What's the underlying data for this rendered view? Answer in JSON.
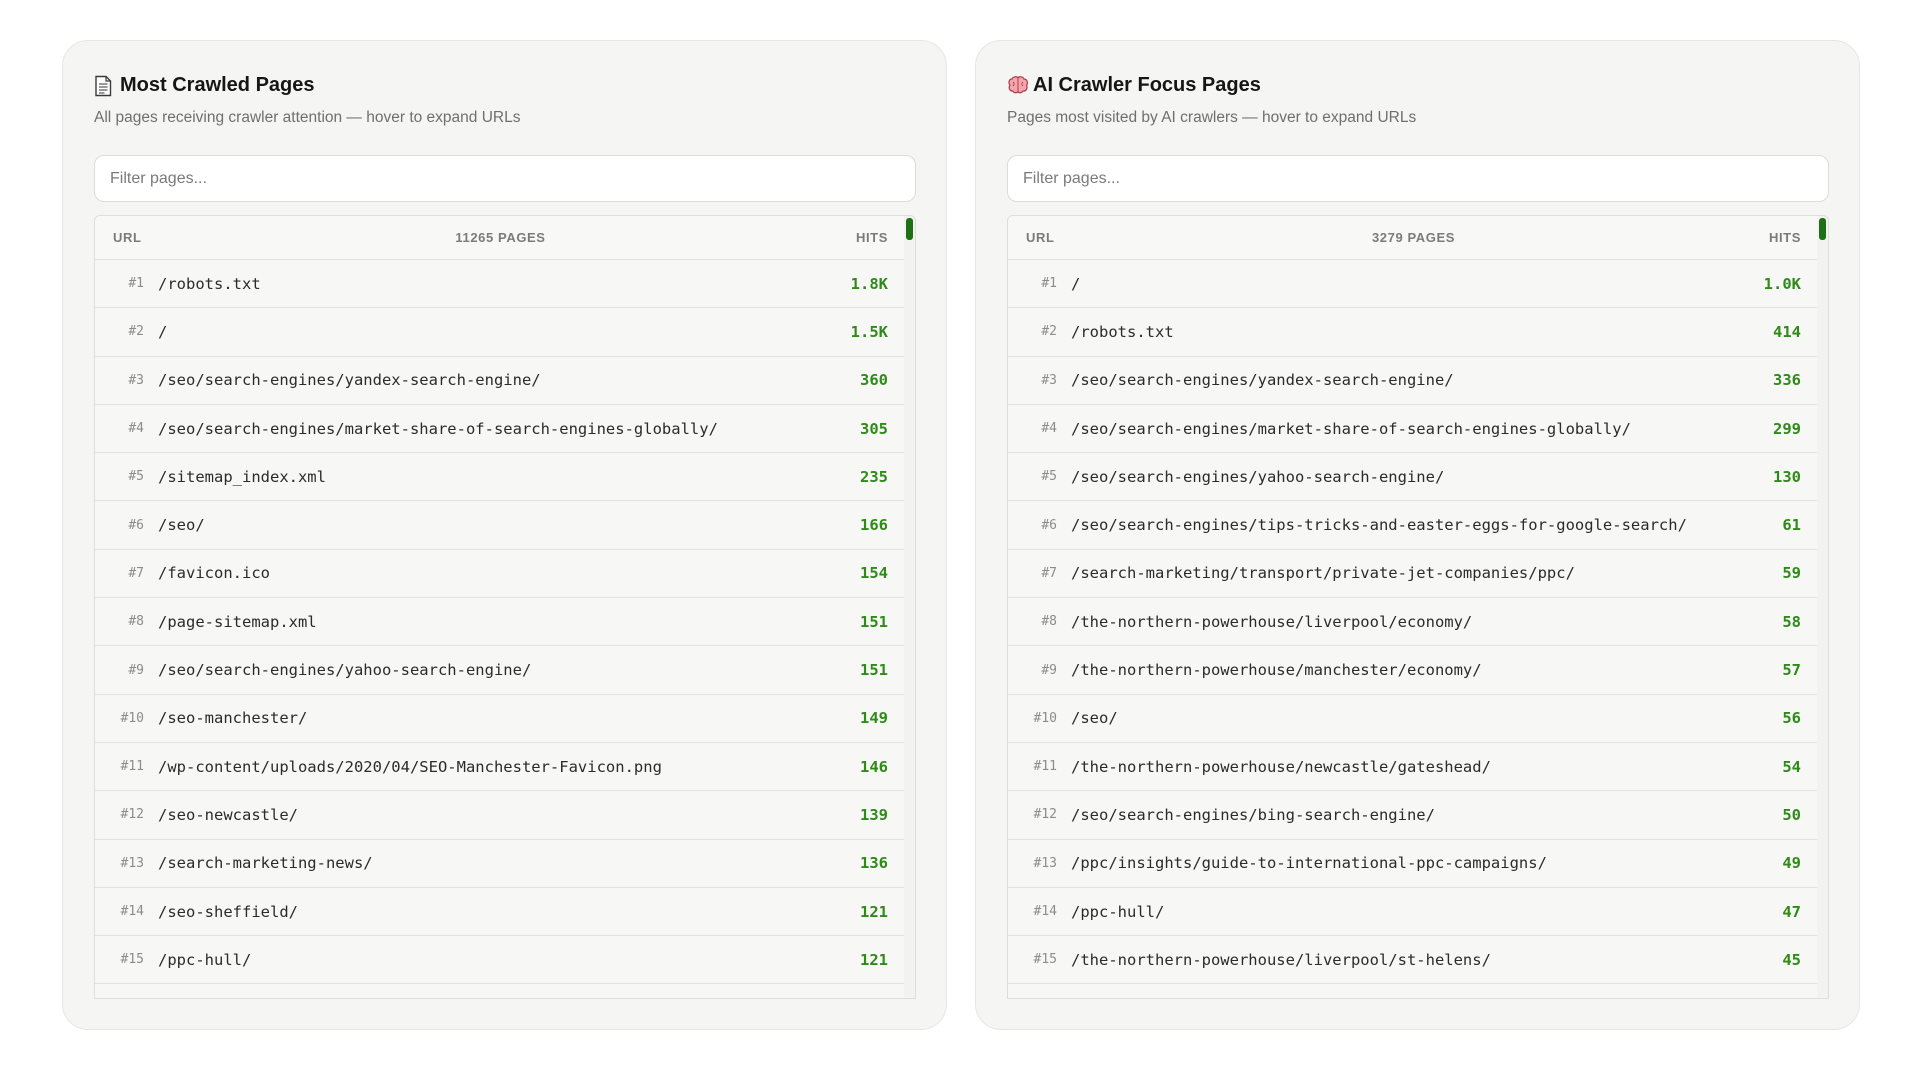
{
  "panels": [
    {
      "icon": "page-facing-up-icon",
      "title": "Most Crawled Pages",
      "subtitle": "All pages receiving crawler attention — hover to expand URLs",
      "filter_placeholder": "Filter pages...",
      "header": {
        "url": "URL",
        "count": "11265 PAGES",
        "hits": "HITS"
      },
      "rows": [
        {
          "rank": "#1",
          "url": "/robots.txt",
          "hits": "1.8K"
        },
        {
          "rank": "#2",
          "url": "/",
          "hits": "1.5K"
        },
        {
          "rank": "#3",
          "url": "/seo/search-engines/yandex-search-engine/",
          "hits": "360"
        },
        {
          "rank": "#4",
          "url": "/seo/search-engines/market-share-of-search-engines-globally/",
          "hits": "305"
        },
        {
          "rank": "#5",
          "url": "/sitemap_index.xml",
          "hits": "235"
        },
        {
          "rank": "#6",
          "url": "/seo/",
          "hits": "166"
        },
        {
          "rank": "#7",
          "url": "/favicon.ico",
          "hits": "154"
        },
        {
          "rank": "#8",
          "url": "/page-sitemap.xml",
          "hits": "151"
        },
        {
          "rank": "#9",
          "url": "/seo/search-engines/yahoo-search-engine/",
          "hits": "151"
        },
        {
          "rank": "#10",
          "url": "/seo-manchester/",
          "hits": "149"
        },
        {
          "rank": "#11",
          "url": "/wp-content/uploads/2020/04/SEO-Manchester-Favicon.png",
          "hits": "146"
        },
        {
          "rank": "#12",
          "url": "/seo-newcastle/",
          "hits": "139"
        },
        {
          "rank": "#13",
          "url": "/search-marketing-news/",
          "hits": "136"
        },
        {
          "rank": "#14",
          "url": "/seo-sheffield/",
          "hits": "121"
        },
        {
          "rank": "#15",
          "url": "/ppc-hull/",
          "hits": "121"
        }
      ]
    },
    {
      "icon": "brain-icon",
      "title": "AI Crawler Focus Pages",
      "subtitle": "Pages most visited by AI crawlers — hover to expand URLs",
      "filter_placeholder": "Filter pages...",
      "header": {
        "url": "URL",
        "count": "3279 PAGES",
        "hits": "HITS"
      },
      "rows": [
        {
          "rank": "#1",
          "url": "/",
          "hits": "1.0K"
        },
        {
          "rank": "#2",
          "url": "/robots.txt",
          "hits": "414"
        },
        {
          "rank": "#3",
          "url": "/seo/search-engines/yandex-search-engine/",
          "hits": "336"
        },
        {
          "rank": "#4",
          "url": "/seo/search-engines/market-share-of-search-engines-globally/",
          "hits": "299"
        },
        {
          "rank": "#5",
          "url": "/seo/search-engines/yahoo-search-engine/",
          "hits": "130"
        },
        {
          "rank": "#6",
          "url": "/seo/search-engines/tips-tricks-and-easter-eggs-for-google-search/",
          "hits": "61"
        },
        {
          "rank": "#7",
          "url": "/search-marketing/transport/private-jet-companies/ppc/",
          "hits": "59"
        },
        {
          "rank": "#8",
          "url": "/the-northern-powerhouse/liverpool/economy/",
          "hits": "58"
        },
        {
          "rank": "#9",
          "url": "/the-northern-powerhouse/manchester/economy/",
          "hits": "57"
        },
        {
          "rank": "#10",
          "url": "/seo/",
          "hits": "56"
        },
        {
          "rank": "#11",
          "url": "/the-northern-powerhouse/newcastle/gateshead/",
          "hits": "54"
        },
        {
          "rank": "#12",
          "url": "/seo/search-engines/bing-search-engine/",
          "hits": "50"
        },
        {
          "rank": "#13",
          "url": "/ppc/insights/guide-to-international-ppc-campaigns/",
          "hits": "49"
        },
        {
          "rank": "#14",
          "url": "/ppc-hull/",
          "hits": "47"
        },
        {
          "rank": "#15",
          "url": "/the-northern-powerhouse/liverpool/st-helens/",
          "hits": "45"
        }
      ]
    }
  ],
  "colors": {
    "accent_green": "#2e8b18",
    "scroll_thumb": "#1f6f14",
    "panel_bg": "#f5f5f4"
  }
}
